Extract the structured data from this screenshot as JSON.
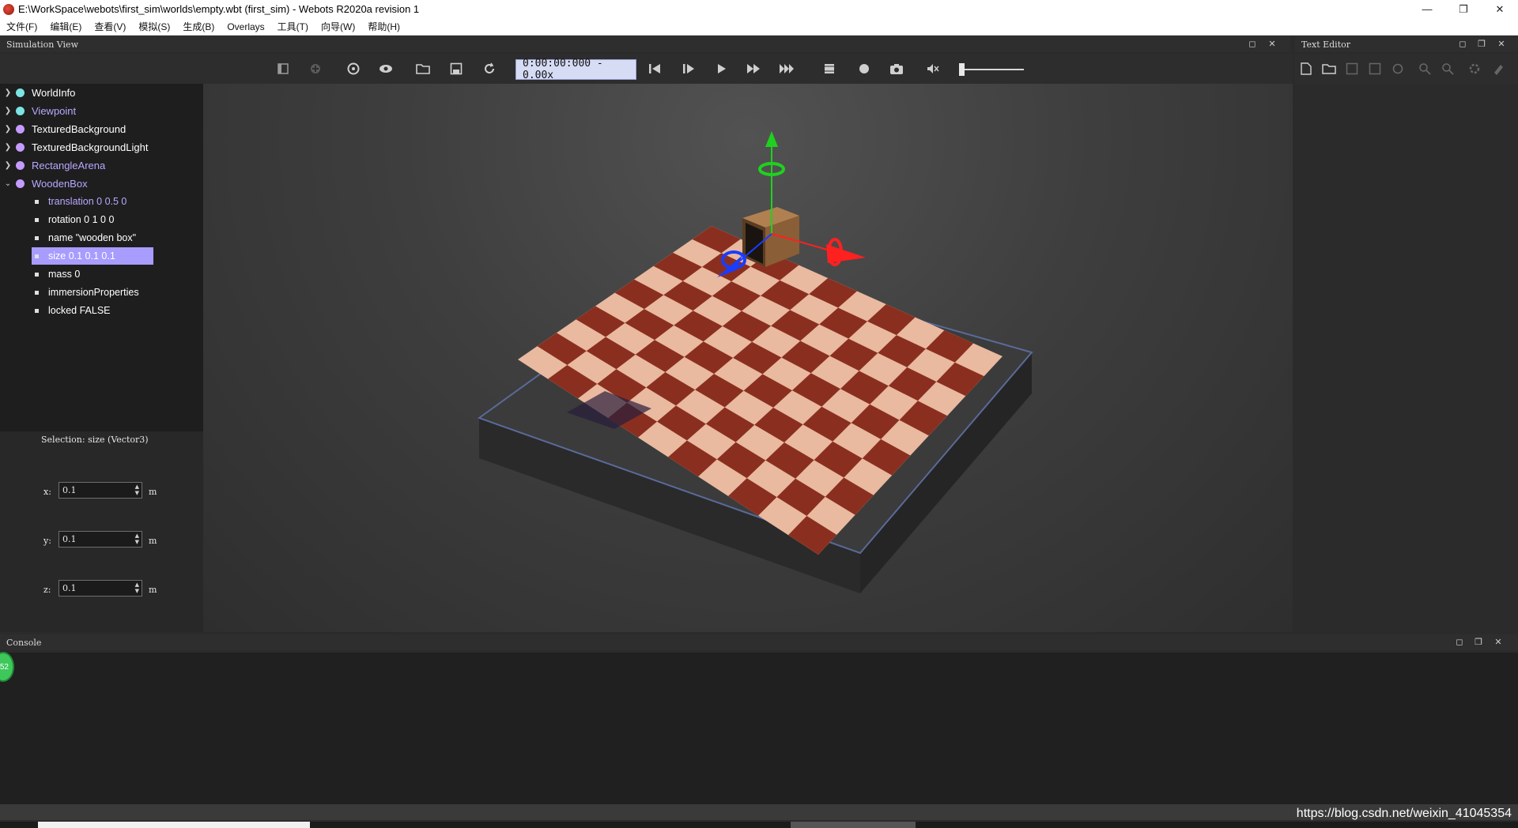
{
  "window": {
    "title": "E:\\WorkSpace\\webots\\first_sim\\worlds\\empty.wbt (first_sim) - Webots R2020a revision 1",
    "minimize": "—",
    "maximize": "❐",
    "close": "✕"
  },
  "menu": [
    "文件(F)",
    "编辑(E)",
    "查看(V)",
    "模拟(S)",
    "生成(B)",
    "Overlays",
    "工具(T)",
    "向导(W)",
    "帮助(H)"
  ],
  "simulation_view": {
    "title": "Simulation View",
    "time": "0:00:00:000  -  0.00x",
    "speed_level": 0.0
  },
  "scene_tree": {
    "nodes": [
      {
        "label": "WorldInfo",
        "color": "#7de3e3",
        "label_color": "#ffffff"
      },
      {
        "label": "Viewpoint",
        "color": "#7de3e3",
        "label_color": "#b9a8ff"
      },
      {
        "label": "TexturedBackground",
        "color": "#c49bff",
        "label_color": "#ffffff"
      },
      {
        "label": "TexturedBackgroundLight",
        "color": "#c49bff",
        "label_color": "#ffffff"
      },
      {
        "label": "RectangleArena",
        "color": "#c49bff",
        "label_color": "#b9a8ff"
      },
      {
        "label": "WoodenBox",
        "color": "#c49bff",
        "label_color": "#b9a8ff"
      }
    ],
    "fields": [
      {
        "label": "translation 0 0.5 0",
        "color": "#b9a8ff"
      },
      {
        "label": "rotation 0 1 0 0",
        "color": "#ffffff"
      },
      {
        "label": "name \"wooden box\"",
        "color": "#ffffff"
      },
      {
        "label": "size 0.1 0.1 0.1",
        "color": "#ffffff",
        "selected": true
      },
      {
        "label": "mass 0",
        "color": "#ffffff"
      },
      {
        "label": "immersionProperties",
        "color": "#ffffff"
      },
      {
        "label": "locked FALSE",
        "color": "#ffffff"
      }
    ]
  },
  "field_editor": {
    "selection": "Selection: size (Vector3)",
    "x_label": "x:",
    "x_value": "0.1",
    "y_label": "y:",
    "y_value": "0.1",
    "z_label": "z:",
    "z_value": "0.1",
    "unit": "m"
  },
  "text_editor": {
    "title": "Text Editor"
  },
  "console": {
    "title": "Console",
    "badge": "52"
  },
  "watermark": "https://blog.csdn.net/weixin_41045354",
  "colors": {
    "selection_highlight": "#a89cff",
    "axis_x": "#ff2020",
    "axis_y": "#1fd11f",
    "axis_z": "#1a3cff"
  }
}
